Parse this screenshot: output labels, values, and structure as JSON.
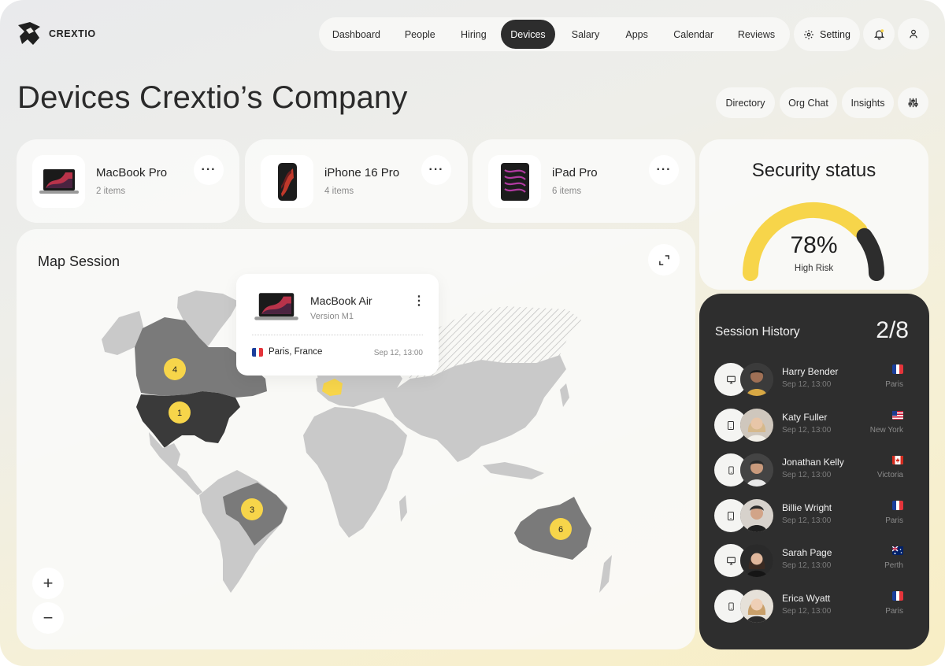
{
  "app": {
    "brand": "CREXTIO"
  },
  "nav": {
    "items": [
      {
        "label": "Dashboard",
        "active": false
      },
      {
        "label": "People",
        "active": false
      },
      {
        "label": "Hiring",
        "active": false
      },
      {
        "label": "Devices",
        "active": true
      },
      {
        "label": "Salary",
        "active": false
      },
      {
        "label": "Apps",
        "active": false
      },
      {
        "label": "Calendar",
        "active": false
      },
      {
        "label": "Reviews",
        "active": false
      }
    ],
    "setting_label": "Setting",
    "icons": [
      "gear-icon",
      "bell-icon",
      "user-icon"
    ]
  },
  "page": {
    "title": "Devices Crextio’s Company",
    "actions": [
      "Directory",
      "Org Chat",
      "Insights"
    ],
    "filter_icon": "sliders-icon"
  },
  "devices": [
    {
      "name": "MacBook Pro",
      "count": "2 items",
      "icon": "laptop-icon"
    },
    {
      "name": "iPhone 16 Pro",
      "count": "4 items",
      "icon": "phone-icon"
    },
    {
      "name": "iPad Pro",
      "count": "6 items",
      "icon": "tablet-icon"
    }
  ],
  "security": {
    "title": "Security status",
    "value": "78%",
    "value_fraction": 0.78,
    "label": "High Risk",
    "colors": {
      "progress": "#f7d54a",
      "remainder": "#2d2d2d"
    }
  },
  "map": {
    "title": "Map Session",
    "expand_icon": "expand-icon",
    "zoom_in": "+",
    "zoom_out": "−",
    "clusters": [
      {
        "region": "Canada",
        "count": "4"
      },
      {
        "region": "USA",
        "count": "1"
      },
      {
        "region": "Brazil",
        "count": "3"
      },
      {
        "region": "Australia",
        "count": "6"
      }
    ],
    "popup": {
      "device": "MacBook Air",
      "version": "Version M1",
      "location": "Paris, France",
      "time": "Sep 12, 13:00",
      "flag": "flag-france-icon"
    },
    "colors": {
      "land": "#c9c9c9",
      "active_land": "#7a7a7a",
      "highlight": "#f7d54a",
      "cluster": "#f7d54a"
    }
  },
  "session": {
    "title": "Session History",
    "count": "2/8",
    "rows": [
      {
        "name": "Harry Bender",
        "time": "Sep 12, 13:00",
        "city": "Paris",
        "device": "monitor-icon",
        "flag": "flag-france-icon"
      },
      {
        "name": "Katy Fuller",
        "time": "Sep 12, 13:00",
        "city": "New York",
        "device": "tablet-icon",
        "flag": "flag-usa-icon"
      },
      {
        "name": "Jonathan Kelly",
        "time": "Sep 12, 13:00",
        "city": "Victoria",
        "device": "phone-icon",
        "flag": "flag-canada-icon"
      },
      {
        "name": "Billie Wright",
        "time": "Sep 12, 13:00",
        "city": "Paris",
        "device": "tablet-icon",
        "flag": "flag-france-icon"
      },
      {
        "name": "Sarah Page",
        "time": "Sep 12, 13:00",
        "city": "Perth",
        "device": "monitor-icon",
        "flag": "flag-australia-icon"
      },
      {
        "name": "Erica Wyatt",
        "time": "Sep 12, 13:00",
        "city": "Paris",
        "device": "phone-icon",
        "flag": "flag-france-icon"
      }
    ]
  }
}
